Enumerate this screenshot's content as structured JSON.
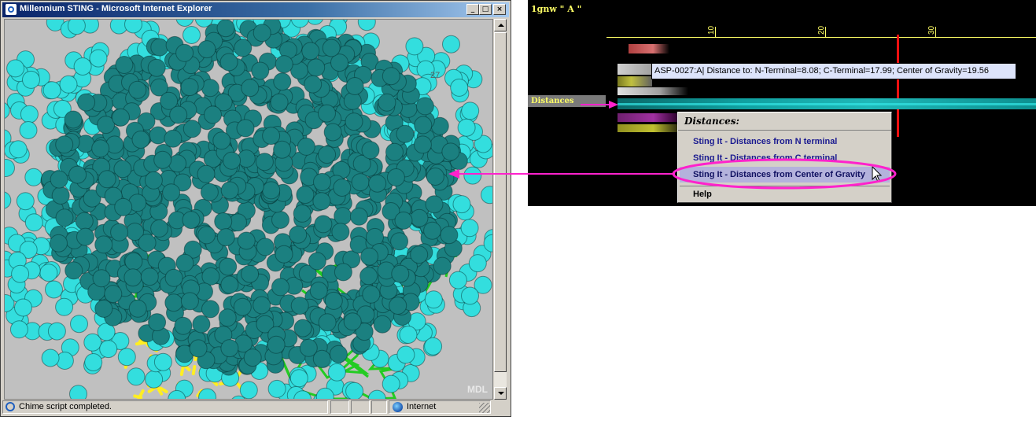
{
  "window": {
    "title": "Millennium STING - Microsoft Internet Explorer",
    "controls": {
      "minimize": "_",
      "maximize": "□",
      "close": "×"
    }
  },
  "viewer": {
    "residue_label": "27",
    "watermark": "MDL"
  },
  "statusbar": {
    "message": "Chime script completed.",
    "zone": "Internet"
  },
  "sting": {
    "chain_title": "1gnw \" A \"",
    "axis_ticks": [
      "10",
      "20",
      "30"
    ],
    "tooltip": "ASP-0027:A| Distance to: N-Terminal=8.08; C-Terminal=17.99; Center of Gravity=19.56",
    "track_label": "Distances",
    "menu": {
      "header": "Distances:",
      "items": [
        "Sting It - Distances from N terminal",
        "Sting It - Distances from C terminal",
        "Sting It - Distances from Center of Gravity"
      ],
      "highlighted_index": 2,
      "help": "Help"
    }
  },
  "colors": {
    "title_bar": "#0a246a",
    "panel_bg": "#000000",
    "axis": "#ffff66",
    "marker": "#ff1010",
    "annotation": "#ff22cc",
    "atom_dark": "#1b8080",
    "atom_light": "#33dede",
    "backbone": "#22cc22",
    "ligand": "#ffee22"
  }
}
